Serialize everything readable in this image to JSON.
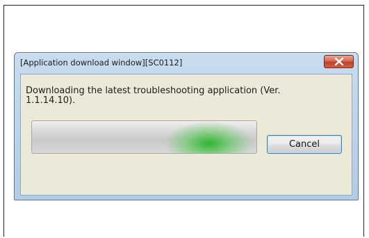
{
  "dialog": {
    "title": "[Application download window][SC0112]",
    "message": "Downloading the latest troubleshooting application (Ver. 1.1.14.10).",
    "cancel_label": "Cancel"
  },
  "icons": {
    "close": "close-icon"
  },
  "colors": {
    "titlebar": "#b9d0e8",
    "client_background": "#ece9d8",
    "close_button": "#c94a33",
    "progress_glow": "#2fb52f",
    "button_focus_border": "#3c7fb1"
  }
}
